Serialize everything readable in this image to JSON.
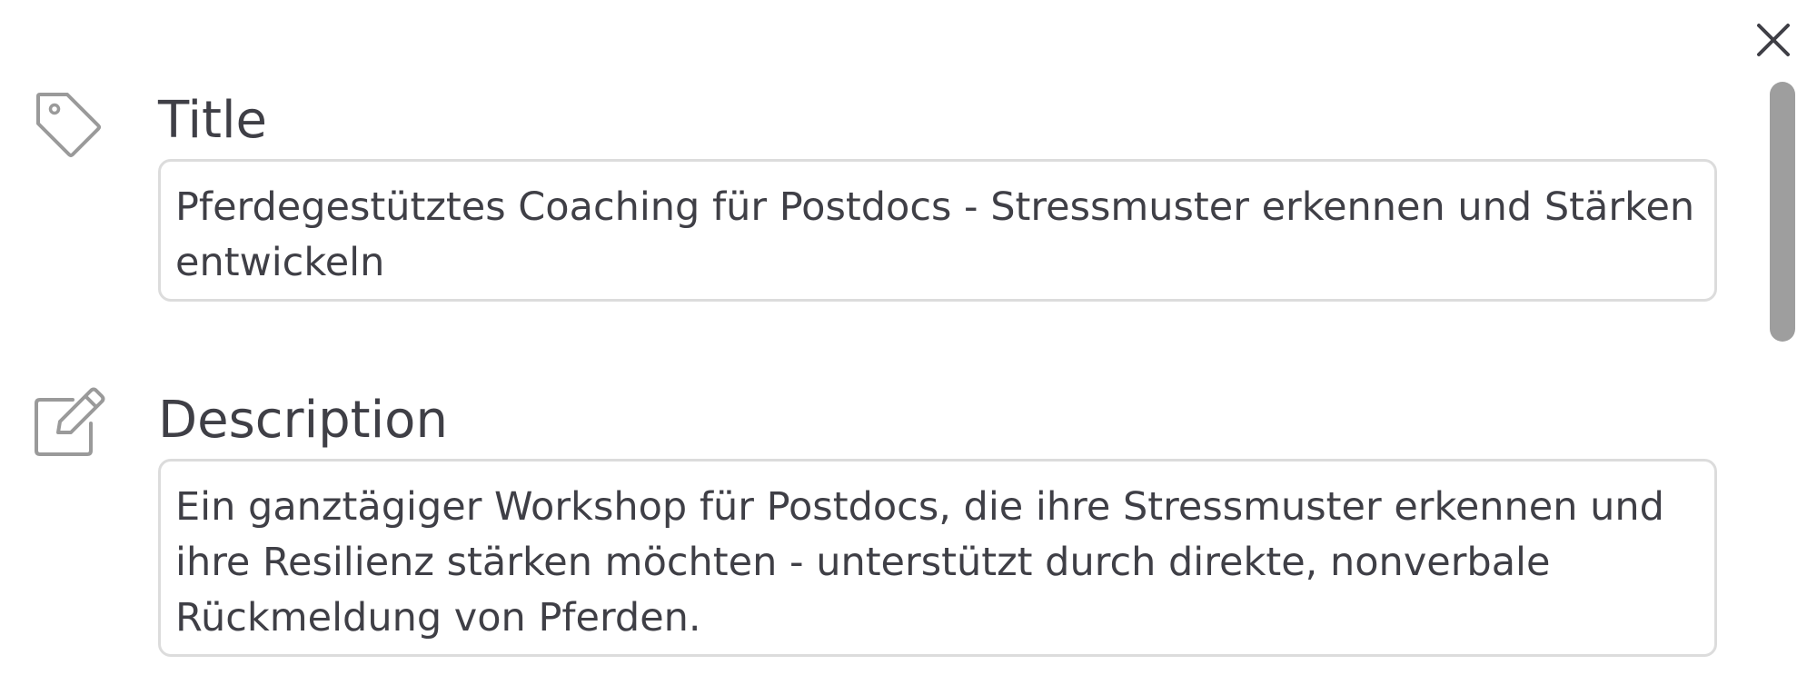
{
  "close": {
    "icon": "close-icon"
  },
  "title_field": {
    "icon": "tag-icon",
    "label": "Title",
    "value": "Pferdegestütztes Coaching für Postdocs - Stressmuster erkennen und Stärken entwickeln"
  },
  "description_field": {
    "icon": "edit-icon",
    "label": "Description",
    "value": "Ein ganztägiger Workshop für Postdocs, die ihre Stressmuster erkennen und ihre Resilienz stärken möchten - unterstützt durch direkte, nonverbale Rückmeldung von Pferden."
  },
  "colors": {
    "text": "#3f3f46",
    "icon": "#9a9a9a",
    "border": "#dcdcdc",
    "scrollbar": "#9e9e9e"
  }
}
